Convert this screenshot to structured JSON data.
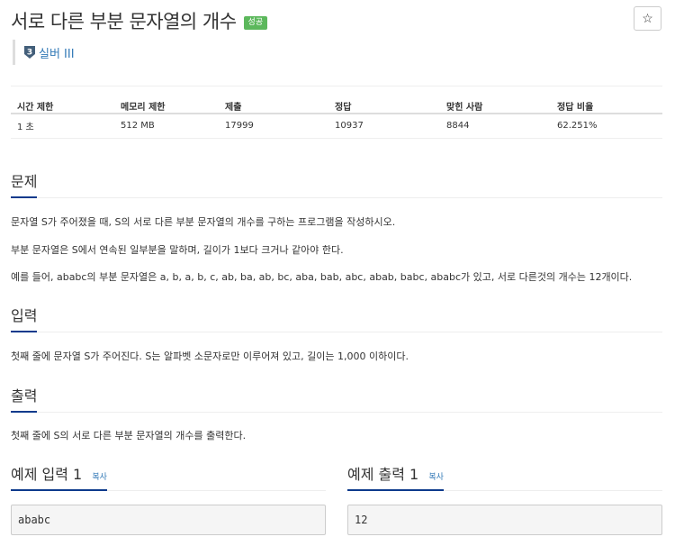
{
  "problem": {
    "title": "서로 다른 부분 문자열의 개수",
    "status_badge": "성공",
    "star_icon": "☆",
    "tier": {
      "number": "3",
      "label": "실버 III",
      "color": "#435f7a"
    }
  },
  "info_table": {
    "headers": [
      "시간 제한",
      "메모리 제한",
      "제출",
      "정답",
      "맞힌 사람",
      "정답 비율"
    ],
    "row": [
      "1 초",
      "512 MB",
      "17999",
      "10937",
      "8844",
      "62.251%"
    ]
  },
  "sections": {
    "problem": {
      "heading": "문제",
      "paragraphs": [
        "문자열 S가 주어졌을 때, S의 서로 다른 부분 문자열의 개수를 구하는 프로그램을 작성하시오.",
        "부분 문자열은 S에서 연속된 일부분을 말하며, 길이가 1보다 크거나 같아야 한다.",
        "예를 들어, ababc의 부분 문자열은 a, b, a, b, c, ab, ba, ab, bc, aba, bab, abc, abab, babc, ababc가 있고, 서로 다른것의 개수는 12개이다."
      ]
    },
    "input": {
      "heading": "입력",
      "paragraphs": [
        "첫째 줄에 문자열 S가 주어진다. S는 알파벳 소문자로만 이루어져 있고, 길이는 1,000 이하이다."
      ]
    },
    "output": {
      "heading": "출력",
      "paragraphs": [
        "첫째 줄에 S의 서로 다른 부분 문자열의 개수를 출력한다."
      ]
    }
  },
  "samples": {
    "input": {
      "label": "예제 입력 1",
      "copy_label": "복사",
      "value": "ababc"
    },
    "output": {
      "label": "예제 출력 1",
      "copy_label": "복사",
      "value": "12"
    }
  },
  "colors": {
    "accent": "#0d3a8c",
    "link": "#337ab7",
    "success": "#5cb85c"
  }
}
